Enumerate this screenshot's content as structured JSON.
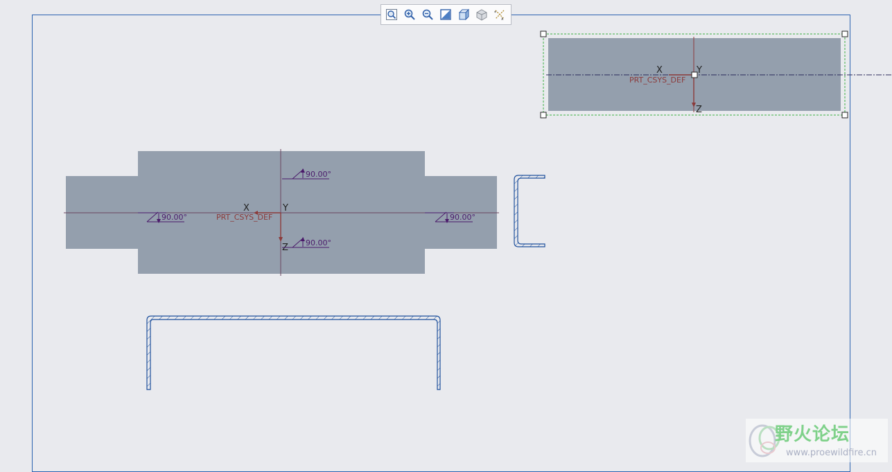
{
  "toolbar": {
    "tools": [
      {
        "icon": "zoom-fit-icon"
      },
      {
        "icon": "zoom-in-icon"
      },
      {
        "icon": "zoom-out-icon"
      },
      {
        "icon": "repaint-icon"
      },
      {
        "icon": "display-style-icon"
      },
      {
        "icon": "saved-view-icon"
      },
      {
        "icon": "datum-display-icon"
      }
    ]
  },
  "main_view": {
    "csys_label": "PRT_CSYS_DEF",
    "axis_x": "X",
    "axis_y": "Y",
    "axis_z": "Z",
    "angles": {
      "top": "90.00°",
      "left": "90.00°",
      "right": "90.00°",
      "bottom": "90.00°"
    }
  },
  "top_right_view": {
    "csys_label": "PRT_CSYS_DEF",
    "axis_x": "X",
    "axis_y": "Y",
    "axis_z": "Z"
  },
  "watermark": {
    "title": "野火论坛",
    "url": "www.proewildfire.cn"
  },
  "colors": {
    "sheet_bg": "#e9eaee",
    "border": "#2a62b0",
    "part_fill": "#949fad",
    "csys": "#8b3a3a",
    "dimension": "#4a1a6a",
    "section_line": "#1d4f9c",
    "selection": "#3cb043"
  }
}
